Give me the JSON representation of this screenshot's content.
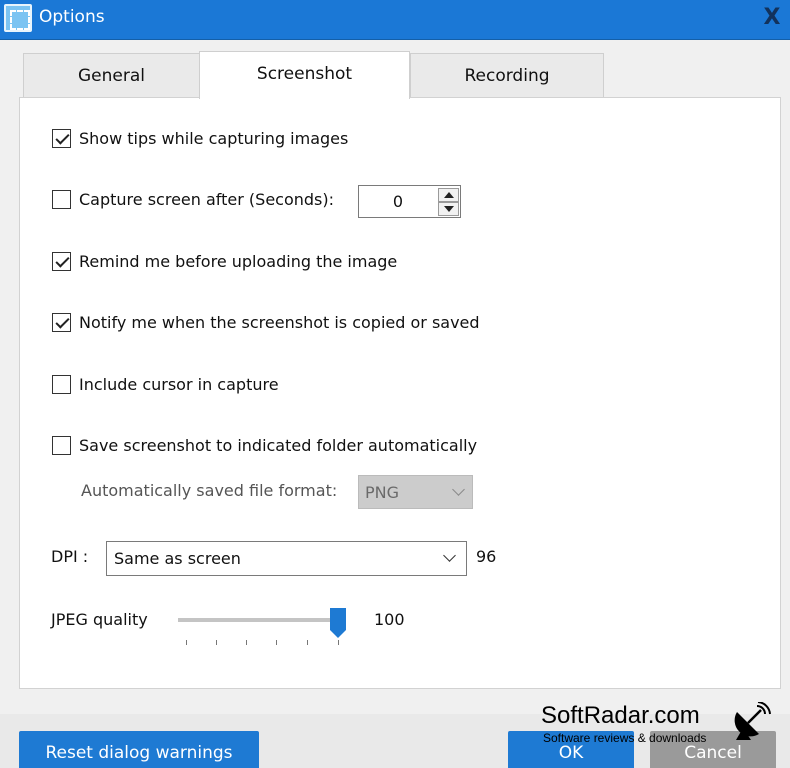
{
  "window": {
    "title": "Options",
    "close_glyph": "X"
  },
  "tabs": [
    {
      "label": "General",
      "active": false
    },
    {
      "label": "Screenshot",
      "active": true
    },
    {
      "label": "Recording",
      "active": false
    }
  ],
  "options": {
    "show_tips": {
      "label": "Show tips while capturing images",
      "checked": true
    },
    "capture_delay": {
      "label": "Capture screen after (Seconds):",
      "checked": false,
      "value": "0"
    },
    "remind_upload": {
      "label": "Remind me before uploading the image",
      "checked": true
    },
    "notify_copied": {
      "label": "Notify me when the screenshot is copied or saved",
      "checked": true
    },
    "include_cursor": {
      "label": "Include cursor in capture",
      "checked": false
    },
    "auto_save": {
      "label": "Save screenshot to indicated folder automatically",
      "checked": false
    }
  },
  "auto_format": {
    "label": "Automatically saved file format:",
    "value": "PNG",
    "enabled": false
  },
  "dpi": {
    "label": "DPI :",
    "value": "Same as screen",
    "readout": "96"
  },
  "jpeg_quality": {
    "label": "JPEG quality",
    "value": "100",
    "fraction": 1.0
  },
  "footer": {
    "reset_label": "Reset dialog warnings",
    "ok_label": "OK",
    "cancel_label": "Cancel"
  },
  "watermark": {
    "title": "SoftRadar.com",
    "subtitle": "Software reviews & downloads"
  },
  "colors": {
    "titlebar": "#1b78d6",
    "accent": "#1e7ad3",
    "panel": "#ffffff"
  }
}
